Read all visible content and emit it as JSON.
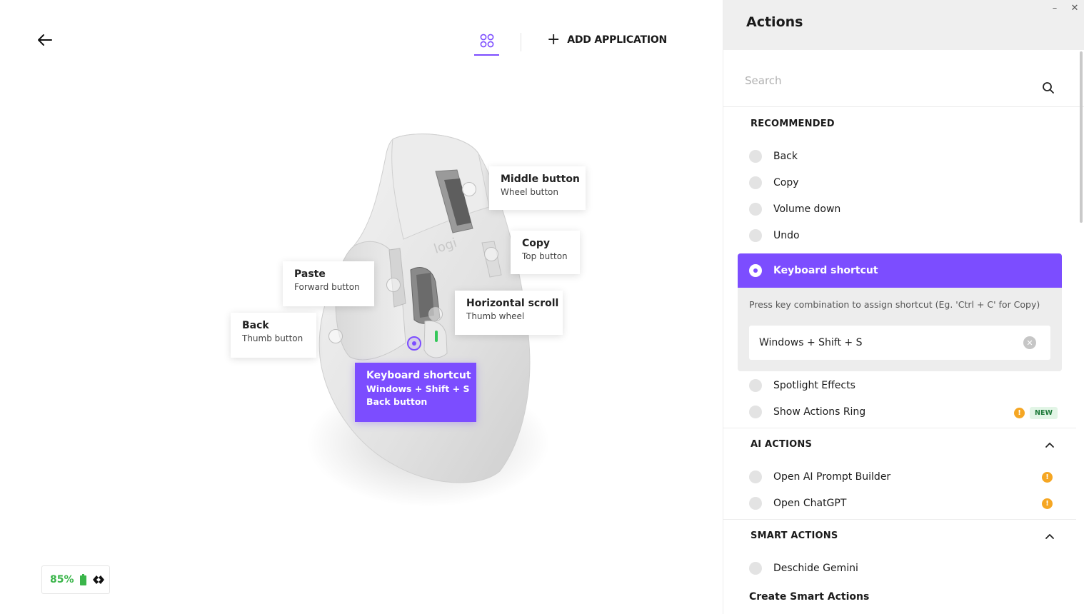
{
  "window": {
    "minimize": "–",
    "close": "✕"
  },
  "nav": {
    "add_application": "ADD APPLICATION"
  },
  "callouts": {
    "middle": {
      "title": "Middle button",
      "subtitle": "Wheel button"
    },
    "copy": {
      "title": "Copy",
      "subtitle": "Top button"
    },
    "paste": {
      "title": "Paste",
      "subtitle": "Forward button"
    },
    "hscroll": {
      "title": "Horizontal scroll",
      "subtitle": "Thumb wheel"
    },
    "back": {
      "title": "Back",
      "subtitle": "Thumb button"
    },
    "active": {
      "title": "Keyboard shortcut",
      "value": "Windows + Shift + S",
      "subtitle": "Back button"
    }
  },
  "battery": {
    "percent": "85%",
    "percent_value": 85
  },
  "panel": {
    "title": "Actions",
    "search_placeholder": "Search",
    "recommended_label": "RECOMMENDED",
    "recommended": [
      "Back",
      "Copy",
      "Volume down",
      "Undo"
    ],
    "keyboard_shortcut": {
      "label": "Keyboard shortcut",
      "hint": "Press key combination to assign shortcut (Eg. 'Ctrl + C' for Copy)",
      "value": "Windows + Shift + S"
    },
    "more_recommended": [
      "Spotlight Effects",
      "Show Actions Ring"
    ],
    "new_badge": "NEW",
    "ai_label": "AI ACTIONS",
    "ai_actions": [
      "Open AI Prompt Builder",
      "Open ChatGPT"
    ],
    "smart_label": "SMART ACTIONS",
    "smart_actions": [
      "Deschide Gemini"
    ],
    "create_smart": "Create Smart Actions"
  },
  "colors": {
    "accent": "#7c4dff",
    "battery": "#3ab54a",
    "warning": "#f5a623"
  },
  "icons": [
    "back-arrow-icon",
    "apps-grid-icon",
    "plus-icon",
    "search-icon",
    "clear-icon",
    "warning-icon",
    "chevron-up-icon",
    "battery-icon",
    "logi-bolt-icon"
  ]
}
